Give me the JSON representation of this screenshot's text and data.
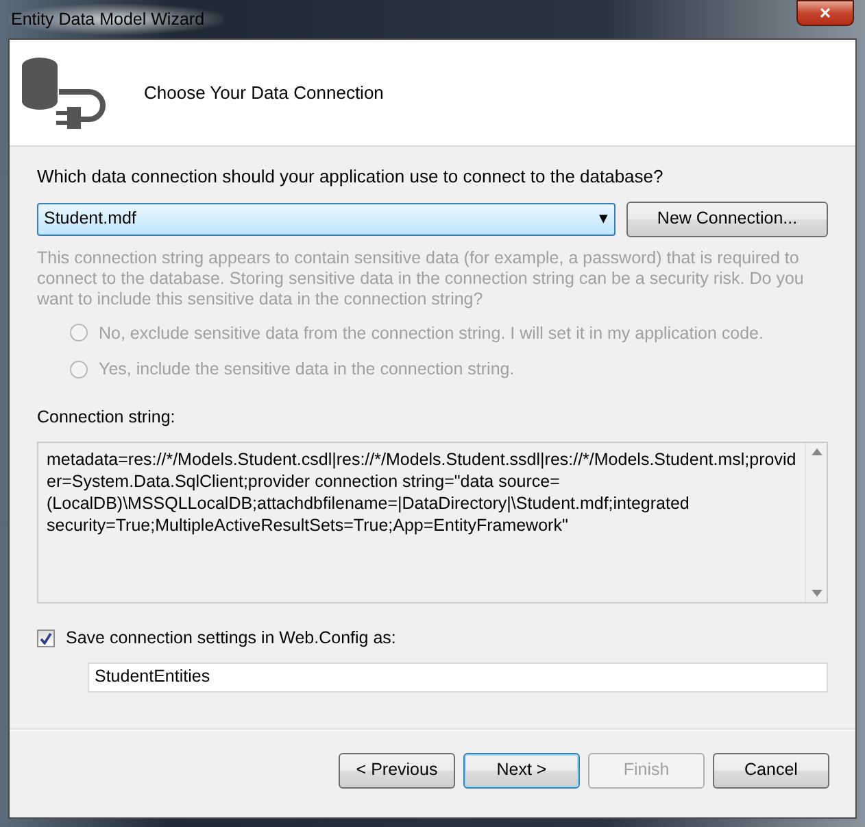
{
  "window": {
    "title": "Entity Data Model Wizard",
    "close_label": "×"
  },
  "header": {
    "title": "Choose Your Data Connection"
  },
  "question": "Which data connection should your application use to connect to the database?",
  "connection_dropdown": {
    "value": "Student.mdf",
    "caret": "▾"
  },
  "new_connection_button": {
    "label": "New Connection...",
    "disabled": false
  },
  "sensitive_note": {
    "text": "This connection string appears to contain sensitive data (for example, a password) that is required to connect to the database. Storing sensitive data in the connection string can be a security risk. Do you want to include this sensitive data in the connection string?",
    "disabled": true
  },
  "sensitive_options": [
    {
      "label": "No, exclude sensitive data from the connection string. I will set it in my application code.",
      "selected": false,
      "disabled": true
    },
    {
      "label": "Yes, include the sensitive data in the connection string.",
      "selected": false,
      "disabled": true
    }
  ],
  "connection_string": {
    "label": "Connection string:",
    "value": "metadata=res://*/Models.Student.csdl|res://*/Models.Student.ssdl|res://*/Models.Student.msl;provider=System.Data.SqlClient;provider connection string=\"data source=(LocalDB)\\MSSQLLocalDB;attachdbfilename=|DataDirectory|\\Student.mdf;integrated security=True;MultipleActiveResultSets=True;App=EntityFramework\""
  },
  "save_settings": {
    "label": "Save connection settings in Web.Config as:",
    "checked": true,
    "value": "StudentEntities"
  },
  "buttons": [
    {
      "label": "< Previous",
      "disabled": false,
      "default": false
    },
    {
      "label": "Next >",
      "disabled": false,
      "default": true
    },
    {
      "label": "Finish",
      "disabled": true,
      "default": false
    },
    {
      "label": "Cancel",
      "disabled": false,
      "default": false
    }
  ]
}
